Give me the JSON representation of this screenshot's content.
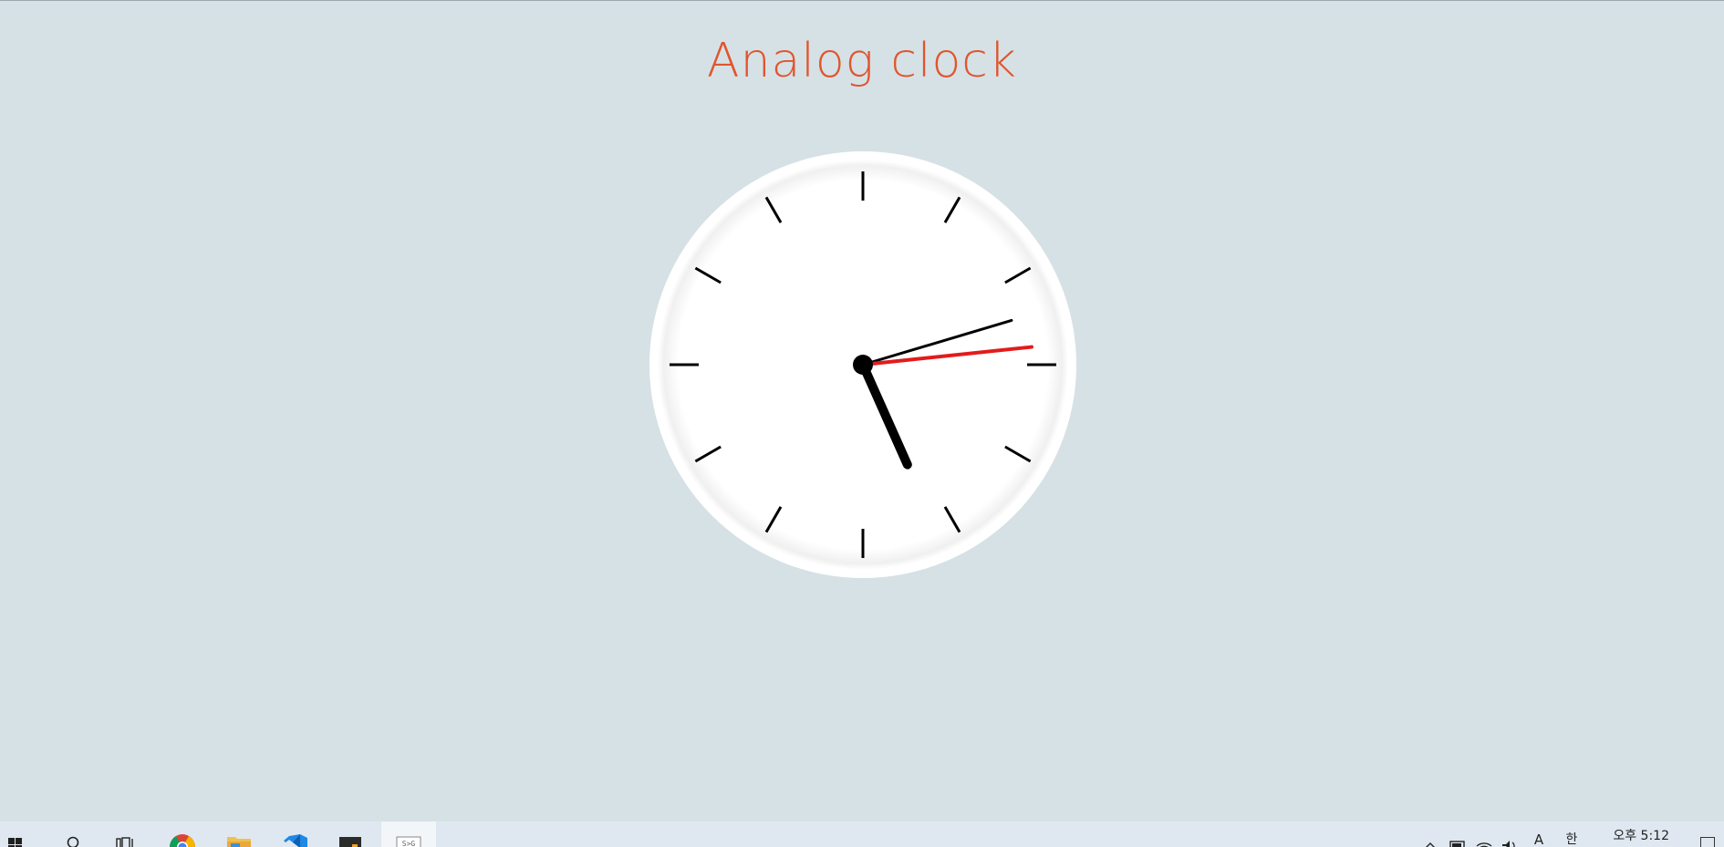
{
  "page": {
    "title": "Analog clock"
  },
  "colors": {
    "background": "#d6e1e5",
    "title": "#e0552e",
    "clock_face": "#ffffff",
    "ticks": "#000000",
    "hour_hand": "#000000",
    "minute_hand": "#000000",
    "second_hand": "#e31b1b"
  },
  "clock": {
    "hour": 5,
    "minute": 12,
    "second": 14
  },
  "taskbar": {
    "items": [
      {
        "name": "start-button",
        "icon": "windows-icon"
      },
      {
        "name": "search-button",
        "icon": "search-icon"
      },
      {
        "name": "task-view-button",
        "icon": "task-view-icon"
      },
      {
        "name": "chrome-button",
        "icon": "chrome-icon"
      },
      {
        "name": "file-explorer-button",
        "icon": "folder-icon"
      },
      {
        "name": "vscode-button",
        "icon": "vscode-icon"
      },
      {
        "name": "terminal-button",
        "icon": "terminal-icon"
      },
      {
        "name": "svg-viewer-button",
        "icon": "svg-icon",
        "active": true
      }
    ],
    "tray_icons": [
      "chevron-up-icon",
      "battery-icon",
      "wifi-icon",
      "volume-icon",
      "ime-mode-icon",
      "ime-lang-icon"
    ],
    "ime_mode_label": "A",
    "ime_lang_label": "한",
    "time_label": "오후 5:12"
  }
}
